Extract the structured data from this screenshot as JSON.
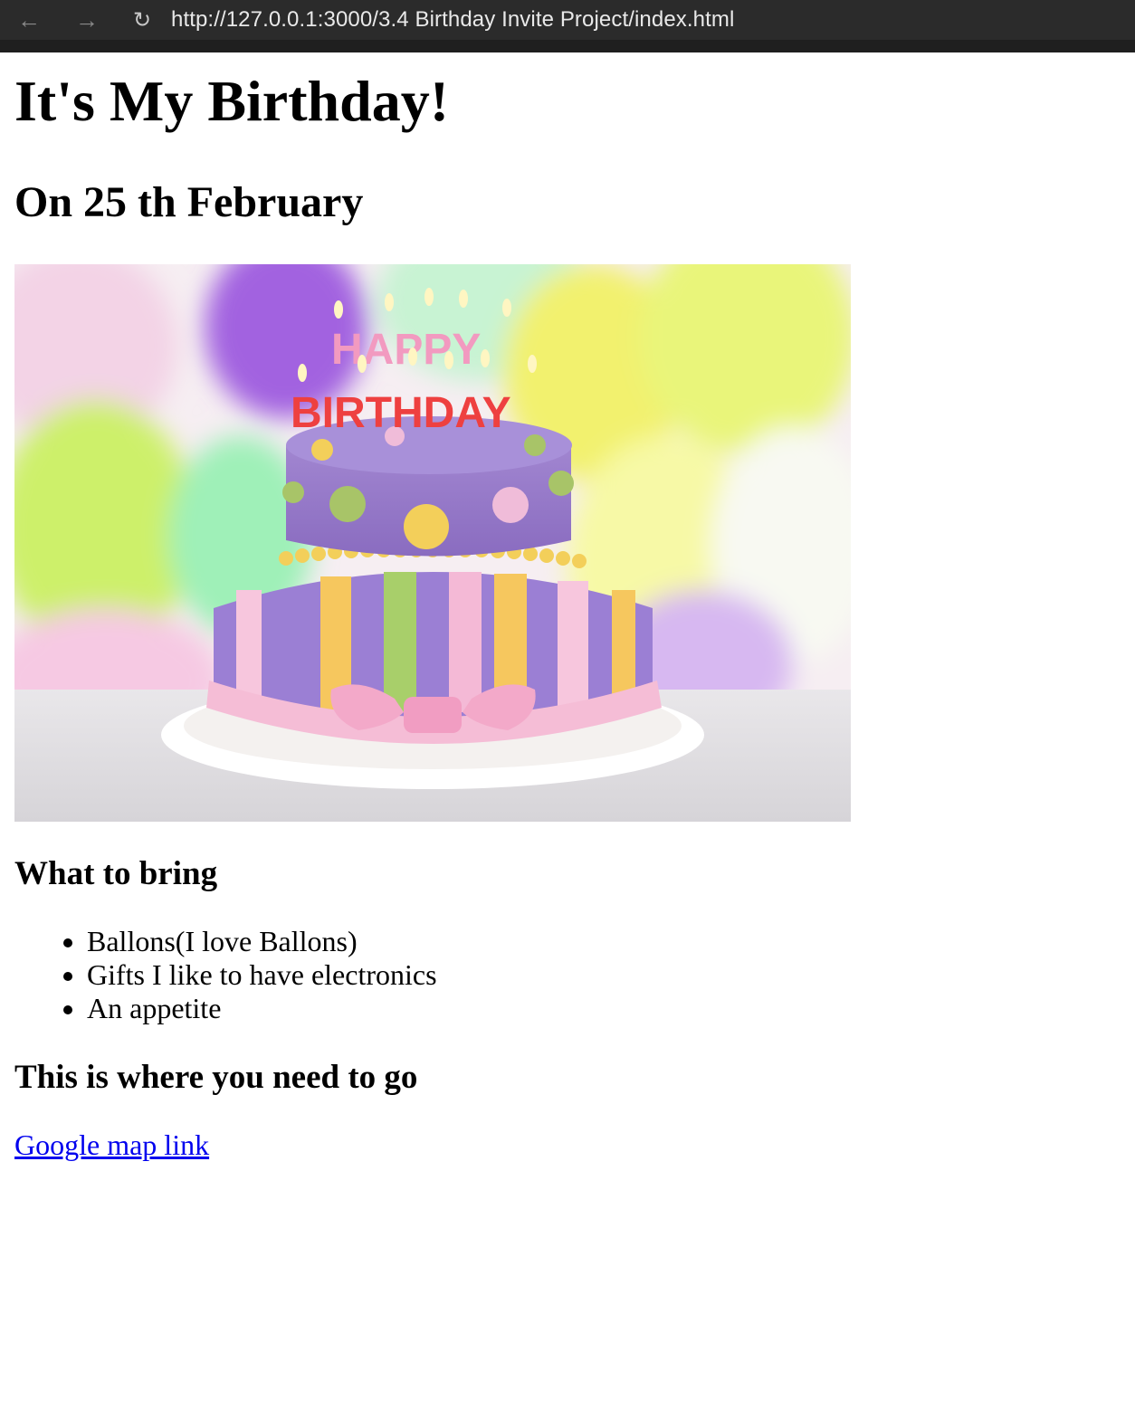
{
  "browser": {
    "back_icon": "arrow-left-icon",
    "forward_icon": "arrow-right-icon",
    "reload_icon": "reload-icon",
    "url": "http://127.0.0.1:3000/3.4 Birthday Invite Project/index.html"
  },
  "page": {
    "title": "It's My Birthday!",
    "date": "On 25 th February",
    "image": {
      "candle_letters_top": "HAPPY",
      "candle_letters_bottom": "BIRTHDAY"
    },
    "bring_heading": "What to bring",
    "bring_items": [
      "Ballons(I love Ballons)",
      "Gifts I like to have electronics",
      "An appetite"
    ],
    "go_heading": "This is where you need to go",
    "map_link": "Google map link"
  }
}
